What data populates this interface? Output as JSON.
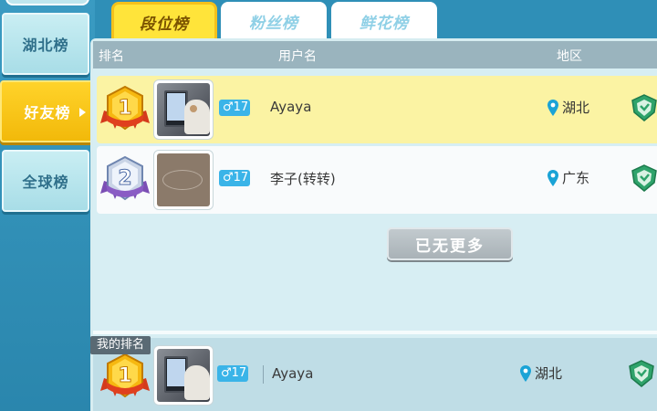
{
  "sidebar": {
    "items": [
      {
        "label": "湖北榜"
      },
      {
        "label": "好友榜"
      },
      {
        "label": "全球榜"
      }
    ]
  },
  "tabs": [
    {
      "label": "段位榜"
    },
    {
      "label": "粉丝榜"
    },
    {
      "label": "鲜花榜"
    }
  ],
  "table": {
    "headers": {
      "rank": "排名",
      "username": "用户名",
      "region": "地区"
    },
    "rows": [
      {
        "rank": "1",
        "level": "17",
        "username": "Ayaya",
        "region": "湖北"
      },
      {
        "rank": "2",
        "level": "17",
        "username": "李子(转转)",
        "region": "广东"
      }
    ]
  },
  "no_more_label": "已无更多",
  "my_rank": {
    "label": "我的排名",
    "rank": "1",
    "level": "17",
    "username": "Ayaya",
    "region": "湖北"
  },
  "colors": {
    "gold_row": "#fbf3a3",
    "active_tab": "#ffe43a",
    "level_badge": "#3ab4e8"
  },
  "icons": {
    "gender": "male-icon",
    "region": "location-pin-icon",
    "rank_badge_1": "gold-medal-icon",
    "rank_badge_2": "silver-medal-icon",
    "tier": "shield-icon"
  }
}
